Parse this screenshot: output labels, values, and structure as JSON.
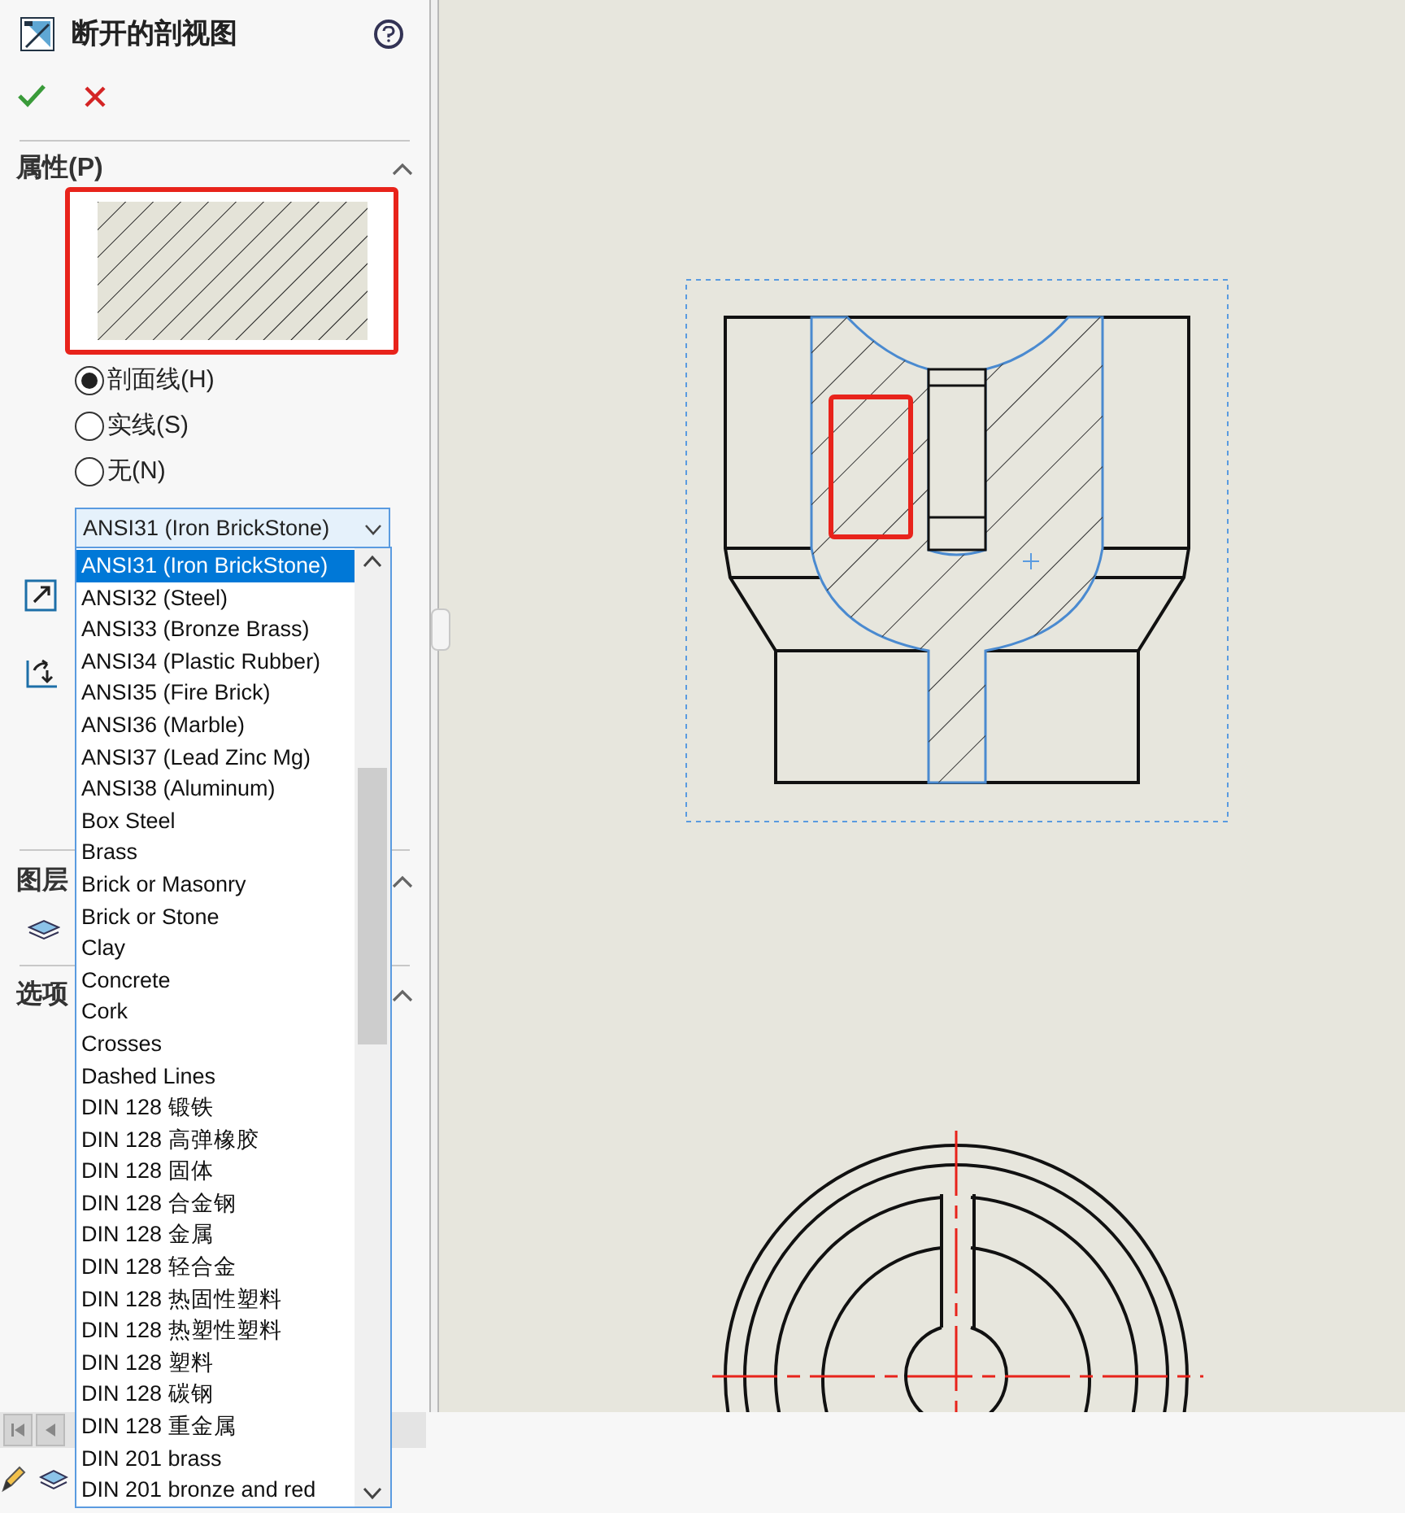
{
  "panel": {
    "title": "断开的剖视图",
    "properties": {
      "title": "属性(P)",
      "expanded": true
    },
    "fill_options": [
      {
        "label": "剖面线(H)",
        "selected": true
      },
      {
        "label": "实线(S)",
        "selected": false
      },
      {
        "label": "无(N)",
        "selected": false
      }
    ],
    "pattern_dropdown": {
      "value": "ANSI31 (Iron BrickStone)",
      "expanded": true,
      "items": [
        {
          "label": "ANSI31 (Iron BrickStone)",
          "selected": true
        },
        {
          "label": "ANSI32 (Steel)",
          "selected": false
        },
        {
          "label": "ANSI33 (Bronze Brass)",
          "selected": false
        },
        {
          "label": "ANSI34 (Plastic Rubber)",
          "selected": false
        },
        {
          "label": "ANSI35 (Fire Brick)",
          "selected": false
        },
        {
          "label": "ANSI36 (Marble)",
          "selected": false
        },
        {
          "label": "ANSI37 (Lead Zinc Mg)",
          "selected": false
        },
        {
          "label": "ANSI38 (Aluminum)",
          "selected": false
        },
        {
          "label": "Box Steel",
          "selected": false
        },
        {
          "label": "Brass",
          "selected": false
        },
        {
          "label": "Brick or Masonry",
          "selected": false
        },
        {
          "label": "Brick or Stone",
          "selected": false
        },
        {
          "label": "Clay",
          "selected": false
        },
        {
          "label": "Concrete",
          "selected": false
        },
        {
          "label": "Cork",
          "selected": false
        },
        {
          "label": "Crosses",
          "selected": false
        },
        {
          "label": "Dashed Lines",
          "selected": false
        },
        {
          "label": "DIN 128 锻铁",
          "selected": false
        },
        {
          "label": "DIN 128 高弹橡胶",
          "selected": false
        },
        {
          "label": "DIN 128 固体",
          "selected": false
        },
        {
          "label": "DIN 128 合金钢",
          "selected": false
        },
        {
          "label": "DIN 128 金属",
          "selected": false
        },
        {
          "label": "DIN 128 轻合金",
          "selected": false
        },
        {
          "label": "DIN 128 热固性塑料",
          "selected": false
        },
        {
          "label": "DIN 128 热塑性塑料",
          "selected": false
        },
        {
          "label": "DIN 128 塑料",
          "selected": false
        },
        {
          "label": "DIN 128 碳钢",
          "selected": false
        },
        {
          "label": "DIN 128 重金属",
          "selected": false
        },
        {
          "label": "DIN 201 brass",
          "selected": false
        },
        {
          "label": "DIN 201 bronze and red",
          "selected": false
        }
      ]
    },
    "layer": {
      "title": "图层",
      "expanded": true
    },
    "options": {
      "title": "选项",
      "expanded": true
    }
  }
}
